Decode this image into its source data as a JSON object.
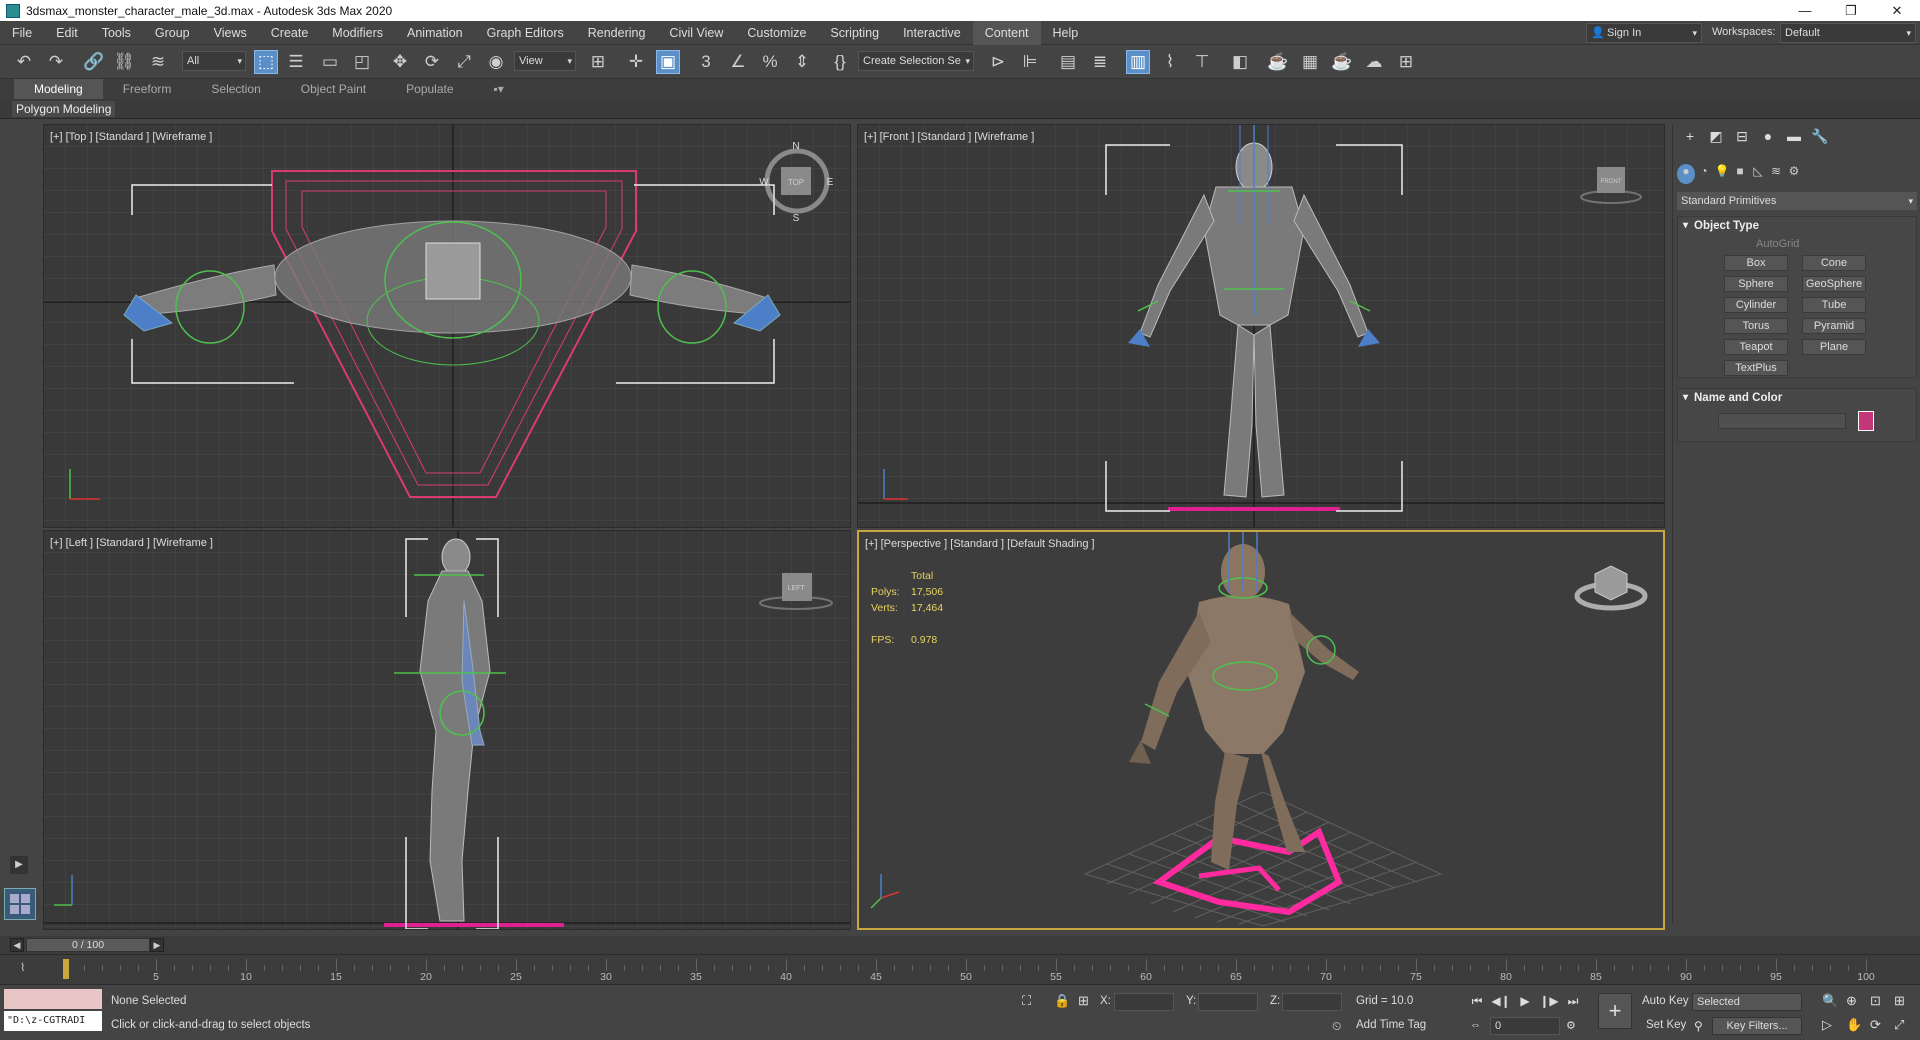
{
  "window": {
    "title": "3dsmax_monster_character_male_3d.max - Autodesk 3ds Max 2020",
    "min": "—",
    "max": "❐",
    "close": "✕"
  },
  "menu": [
    "File",
    "Edit",
    "Tools",
    "Group",
    "Views",
    "Create",
    "Modifiers",
    "Animation",
    "Graph Editors",
    "Rendering",
    "Civil View",
    "Customize",
    "Scripting",
    "Interactive",
    "Content",
    "Help"
  ],
  "account": {
    "signin": "Sign In",
    "workspaces_label": "Workspaces:",
    "workspace": "Default"
  },
  "toolbar": {
    "filter": "All",
    "refcoord": "View",
    "selection_set": "Create Selection Se"
  },
  "ribbon": {
    "tabs": [
      "Modeling",
      "Freeform",
      "Selection",
      "Object Paint",
      "Populate"
    ],
    "sub": "Polygon Modeling"
  },
  "viewports": {
    "top": {
      "label": "[+] [Top ] [Standard ] [Wireframe ]",
      "compass": {
        "n": "N",
        "s": "S",
        "e": "E",
        "w": "W",
        "cube": "TOP"
      }
    },
    "front": {
      "label": "[+] [Front ] [Standard ] [Wireframe ]",
      "cube": "FRONT"
    },
    "left": {
      "label": "[+] [Left ] [Standard ] [Wireframe ]",
      "cube": "LEFT"
    },
    "persp": {
      "label": "[+] [Perspective ] [Standard ] [Default Shading ]",
      "stats": {
        "total": "Total",
        "polys_label": "Polys:",
        "polys": "17,506",
        "verts_label": "Verts:",
        "verts": "17,464",
        "fps_label": "FPS:",
        "fps": "0.978"
      }
    }
  },
  "command_panel": {
    "category": "Standard Primitives",
    "object_type": "Object Type",
    "autogrid": "AutoGrid",
    "buttons": [
      "Box",
      "Cone",
      "Sphere",
      "GeoSphere",
      "Cylinder",
      "Tube",
      "Torus",
      "Pyramid",
      "Teapot",
      "Plane",
      "TextPlus"
    ],
    "name_and_color": "Name and Color",
    "color": "#c5357a"
  },
  "timeline": {
    "frame": "0 / 100",
    "ticks": [
      "5",
      "10",
      "15",
      "20",
      "25",
      "30",
      "35",
      "40",
      "45",
      "50",
      "55",
      "60",
      "65",
      "70",
      "75",
      "80",
      "85",
      "90",
      "95",
      "100"
    ]
  },
  "status": {
    "maxscript": "\"D:\\z-CGTRADI",
    "selection": "None Selected",
    "prompt": "Click or click-and-drag to select objects",
    "x_label": "X:",
    "y_label": "Y:",
    "z_label": "Z:",
    "grid": "Grid = 10.0",
    "add_time_tag": "Add Time Tag",
    "auto_key": "Auto Key",
    "set_key": "Set Key",
    "key_mode": "Selected",
    "key_filters": "Key Filters...",
    "frame_field": "0"
  }
}
